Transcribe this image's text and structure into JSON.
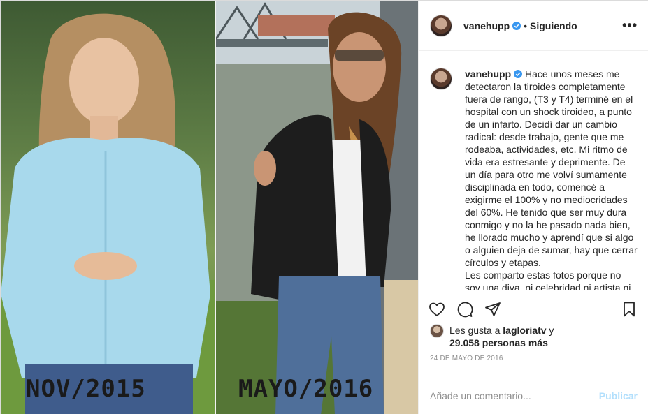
{
  "photo": {
    "left_label": "NOV/2015",
    "right_label": "MAYO/2016"
  },
  "header": {
    "username": "vanehupp",
    "separator": "•",
    "follow_status": "Siguiendo",
    "more": "•••"
  },
  "caption": {
    "username": "vanehupp",
    "paragraphs": [
      "Hace unos meses me detectaron la tiroides completamente fuera de rango, (T3 y T4) terminé en el hospital con un shock tiroideo, a punto de un infarto. Decidí dar un cambio radical: desde trabajo, gente que me rodeaba, actividades, etc. Mi ritmo de vida era estresante y deprimente. De un día para otro me volví sumamente disciplinada en todo, comencé a exigirme el 100% y no mediocridades del 60%. He tenido que ser muy dura conmigo y no la he pasado nada bien, he llorado mucho y aprendí que si algo o alguien deja de sumar, hay que cerrar círculos y etapas.",
      "Les comparto estas fotos porque no soy una diva, ni celebridad ni artista ni"
    ]
  },
  "likes": {
    "prefix": "Les gusta a",
    "user": "lagloriatv",
    "conjunction": "y",
    "count": "29.058 personas más"
  },
  "date": "24 DE MAYO DE 2016",
  "comment_form": {
    "placeholder": "Añade un comentario...",
    "publish": "Publicar"
  },
  "colors": {
    "verified": "#3897f0",
    "publish_disabled": "#b2dffc"
  }
}
